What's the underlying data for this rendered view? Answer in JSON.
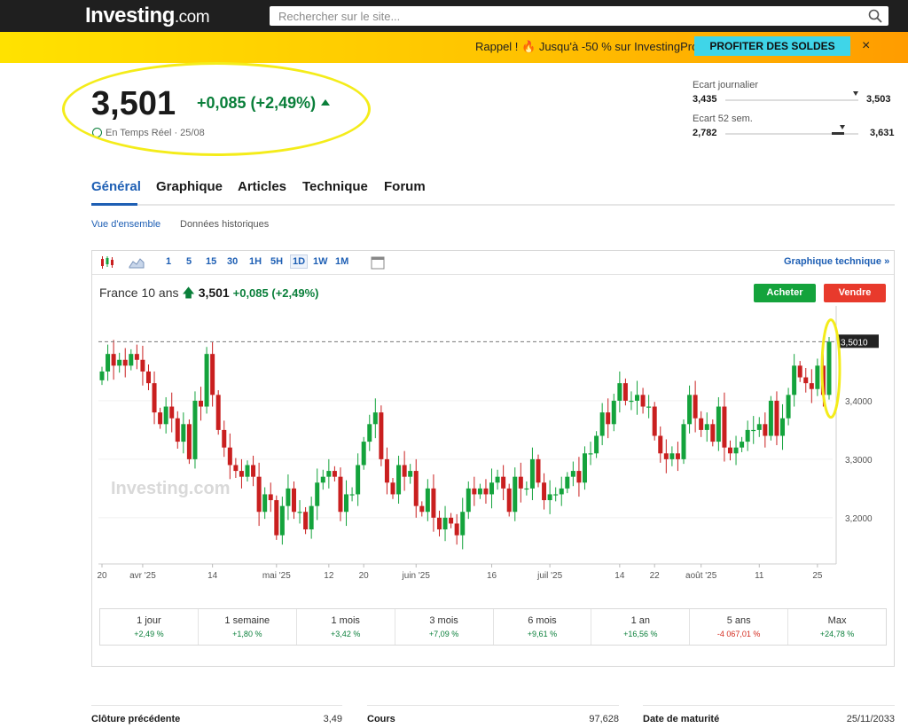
{
  "header": {
    "logo_main": "Investing",
    "logo_suffix": ".com",
    "search_placeholder": "Rechercher sur le site..."
  },
  "promo": {
    "text": "Rappel ! 🔥 Jusqu'à -50 % sur InvestingPro",
    "button": "PROFITER DES SOLDES",
    "close": "×"
  },
  "quote": {
    "price": "3,501",
    "change": "+0,085 (+2,49%)",
    "realtime": "En Temps Réel · 25/08"
  },
  "ranges": {
    "daily_label": "Ecart journalier",
    "daily_low": "3,435",
    "daily_high": "3,503",
    "week52_label": "Ecart 52 sem.",
    "week52_low": "2,782",
    "week52_high": "3,631"
  },
  "tabs": [
    "Général",
    "Graphique",
    "Articles",
    "Technique",
    "Forum"
  ],
  "subtabs": [
    "Vue d'ensemble",
    "Données historiques"
  ],
  "chart_toolbar": {
    "timeframes": [
      "1",
      "5",
      "15",
      "30",
      "1H",
      "5H",
      "1D",
      "1W",
      "1M"
    ],
    "selected": "1D",
    "tech_link": "Graphique technique »"
  },
  "chart_header": {
    "name": "France 10 ans",
    "price": "3,501",
    "change": "+0,085 (+2,49%)",
    "buy": "Acheter",
    "sell": "Vendre"
  },
  "chart_data": {
    "type": "candlestick",
    "watermark": "Investing.com",
    "last_label": "3,5010",
    "y_ticks": [
      "3,4000",
      "3,3000",
      "3,2000"
    ],
    "y_tick_values": [
      3.4,
      3.3,
      3.2
    ],
    "ylim": [
      3.13,
      3.55
    ],
    "x_ticks": [
      "20",
      "avr '25",
      "14",
      "mai '25",
      "12",
      "20",
      "juin '25",
      "16",
      "juil '25",
      "14",
      "22",
      "août '25",
      "11",
      "25"
    ],
    "x_tick_index": [
      0,
      7,
      19,
      30,
      39,
      45,
      54,
      67,
      77,
      89,
      95,
      103,
      113,
      123
    ],
    "closes": [
      3.45,
      3.48,
      3.46,
      3.47,
      3.46,
      3.48,
      3.47,
      3.45,
      3.43,
      3.38,
      3.36,
      3.39,
      3.37,
      3.33,
      3.36,
      3.3,
      3.4,
      3.39,
      3.48,
      3.41,
      3.35,
      3.32,
      3.29,
      3.28,
      3.27,
      3.29,
      3.27,
      3.21,
      3.24,
      3.23,
      3.17,
      3.22,
      3.25,
      3.21,
      3.21,
      3.18,
      3.22,
      3.26,
      3.27,
      3.28,
      3.27,
      3.21,
      3.24,
      3.24,
      3.29,
      3.33,
      3.36,
      3.38,
      3.3,
      3.26,
      3.24,
      3.29,
      3.27,
      3.28,
      3.22,
      3.21,
      3.25,
      3.2,
      3.18,
      3.2,
      3.19,
      3.17,
      3.21,
      3.25,
      3.24,
      3.25,
      3.24,
      3.26,
      3.27,
      3.25,
      3.21,
      3.27,
      3.25,
      3.25,
      3.3,
      3.26,
      3.23,
      3.24,
      3.24,
      3.25,
      3.27,
      3.28,
      3.26,
      3.31,
      3.31,
      3.34,
      3.38,
      3.36,
      3.4,
      3.43,
      3.4,
      3.4,
      3.41,
      3.39,
      3.39,
      3.34,
      3.31,
      3.3,
      3.31,
      3.3,
      3.36,
      3.41,
      3.37,
      3.35,
      3.36,
      3.33,
      3.39,
      3.32,
      3.31,
      3.32,
      3.33,
      3.35,
      3.35,
      3.36,
      3.34,
      3.4,
      3.34,
      3.37,
      3.41,
      3.46,
      3.44,
      3.43,
      3.42,
      3.46,
      3.41,
      3.501
    ]
  },
  "performance": [
    {
      "label": "1 jour",
      "value": "+2,49 %"
    },
    {
      "label": "1 semaine",
      "value": "+1,80 %"
    },
    {
      "label": "1 mois",
      "value": "+3,42 %"
    },
    {
      "label": "3 mois",
      "value": "+7,09 %"
    },
    {
      "label": "6 mois",
      "value": "+9,61 %"
    },
    {
      "label": "1 an",
      "value": "+16,56 %"
    },
    {
      "label": "5 ans",
      "value": "-4 067,01 %"
    },
    {
      "label": "Max",
      "value": "+24,78 %"
    }
  ],
  "details": [
    {
      "label": "Clôture précédente",
      "value": "3,49"
    },
    {
      "label": "Cours",
      "value": "97,628"
    },
    {
      "label": "Date de maturité",
      "value": "25/11/2033"
    }
  ],
  "colors": {
    "up": "#14a33c",
    "down": "#c91f1f",
    "accent": "#1e5fb4",
    "highlight": "#f4ec1a"
  }
}
